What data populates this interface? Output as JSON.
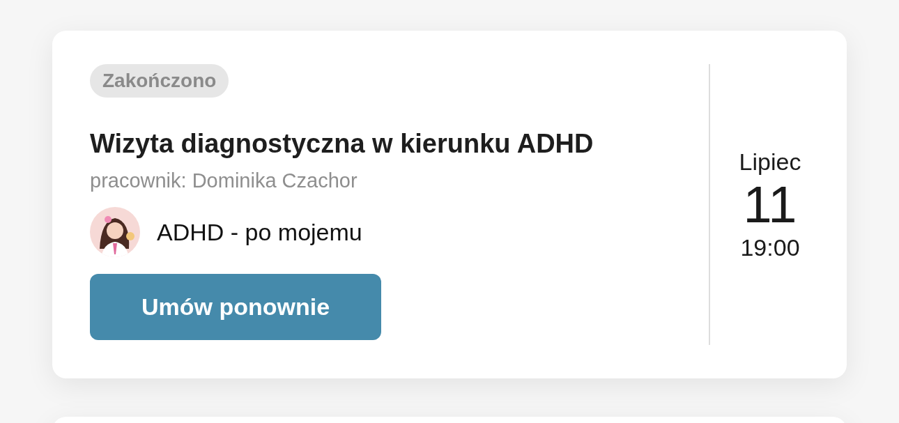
{
  "appointment": {
    "status": "Zakończono",
    "title": "Wizyta diagnostyczna w kierunku ADHD",
    "employee": "pracownik: Dominika Czachor",
    "organization": {
      "name": "ADHD - po mojemu"
    },
    "button": "Umów ponownie",
    "date": {
      "month": "Lipiec",
      "day": "11",
      "time": "19:00"
    }
  }
}
